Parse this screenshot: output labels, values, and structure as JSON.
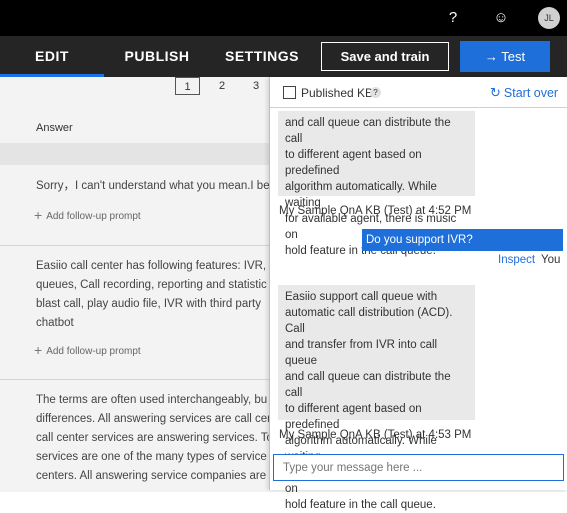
{
  "topbar": {
    "help_glyph": "?",
    "feedback_glyph": "☺",
    "avatar_initials": "JL"
  },
  "nav": {
    "tabs": [
      {
        "label": "EDIT"
      },
      {
        "label": "PUBLISH"
      },
      {
        "label": "SETTINGS"
      }
    ],
    "save_label": "Save and train",
    "test_label": "→ Test",
    "accent": "#1e6fd9"
  },
  "pager": [
    "1",
    "2",
    "3"
  ],
  "table": {
    "answer_header": "Answer",
    "follow_up_label": "Add follow-up prompt",
    "rows": [
      {
        "lines": [
          "Sorry，I can't understand what you mean.I be"
        ]
      },
      {
        "lines": [
          "Easiio call center has following features: IVR,",
          "queues, Call recording, reporting and statistic",
          "blast call, play audio file, IVR with third party",
          "chatbot"
        ]
      },
      {
        "lines": [
          "The terms are often used interchangeably, bu",
          "differences. All answering services are call cer",
          "call center services are answering services. To",
          "services are one of the many types of service",
          "centers. All answering service companies are"
        ]
      }
    ]
  },
  "test_panel": {
    "published_kb_label": "Published KB",
    "info_glyph": "?",
    "start_over_label": "Start over",
    "bot_message_1_lines": [
      "and call queue can distribute the call",
      "to different agent based on predefined",
      "algorithm automatically. While waiting",
      "for available agent, there is music on",
      "hold feature in the call queue."
    ],
    "meta_1": "My Sample QnA KB (Test) at 4:52 PM",
    "user_message": "Do you support IVR?",
    "inspect_label": "Inspect",
    "you_label": "You",
    "bot_message_2_lines": [
      "Easiio support call queue with",
      "automatic call distribution (ACD). Call",
      "and transfer from IVR into call queue",
      "and call queue can distribute the call",
      "to different agent based on predefined",
      "algorithm automatically. While waiting",
      "for available agent, there is music on",
      "hold feature in the call queue."
    ],
    "meta_2": "My Sample QnA KB (Test) at 4:53 PM",
    "input_placeholder": "Type your message here ..."
  }
}
